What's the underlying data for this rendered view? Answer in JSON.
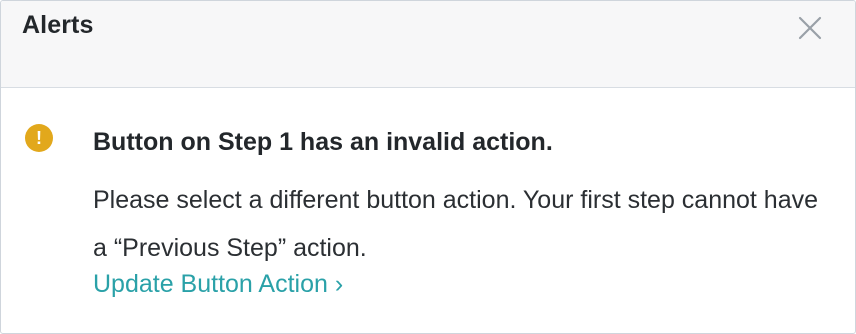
{
  "header": {
    "title": "Alerts",
    "close_icon": "close-icon"
  },
  "alert": {
    "icon": "warning-icon",
    "icon_glyph": "!",
    "icon_color": "#e2a81c",
    "title": "Button on Step 1 has an invalid action.",
    "message": "Please select a different button action. Your first step cannot have a “Previous Step” action.",
    "link_label": "Update Button Action ›",
    "link_color": "#2aa1a8"
  }
}
